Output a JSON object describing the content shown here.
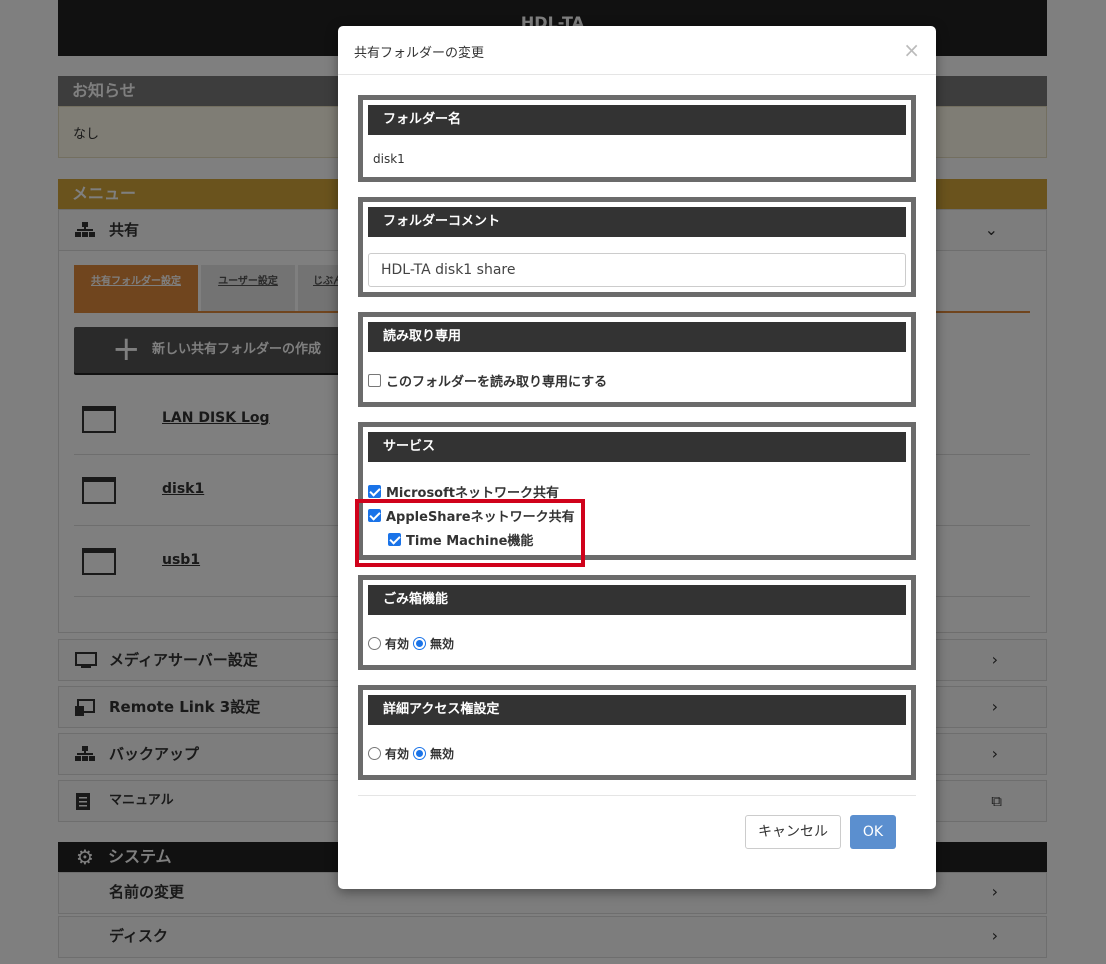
{
  "app": {
    "title": "HDL-TA"
  },
  "notice": {
    "heading": "お知らせ",
    "body": "なし"
  },
  "menu": {
    "heading": "メニュー",
    "share": {
      "label": "共有"
    },
    "tabs": [
      {
        "label": "共有フォルダー設定"
      },
      {
        "label": "ユーザー設定"
      },
      {
        "label": "じぶん"
      }
    ],
    "new_folder_button": "新しい共有フォルダーの作成",
    "folders": [
      {
        "name": "LAN DISK Log"
      },
      {
        "name": "disk1"
      },
      {
        "name": "usb1"
      }
    ],
    "rows": [
      {
        "label": "メディアサーバー設定"
      },
      {
        "label": "Remote Link 3設定"
      },
      {
        "label": "バックアップ"
      },
      {
        "label": "マニュアル"
      }
    ]
  },
  "system": {
    "heading": "システム",
    "rows": [
      {
        "label": "名前の変更"
      },
      {
        "label": "ディスク"
      }
    ]
  },
  "modal": {
    "title": "共有フォルダーの変更",
    "close_symbol": "×",
    "folder_name": {
      "heading": "フォルダー名",
      "value": "disk1"
    },
    "folder_comment": {
      "heading": "フォルダーコメント",
      "value": "HDL-TA disk1 share"
    },
    "read_only": {
      "heading": "読み取り専用",
      "option_label": "このフォルダーを読み取り専用にする",
      "checked": false
    },
    "service": {
      "heading": "サービス",
      "options": [
        {
          "label": "Microsoftネットワーク共有",
          "checked": true
        },
        {
          "label": "AppleShareネットワーク共有",
          "checked": true
        },
        {
          "label": "Time Machine機能",
          "checked": true
        }
      ]
    },
    "trash": {
      "heading": "ごみ箱機能",
      "enabled_label": "有効",
      "disabled_label": "無効",
      "selected": "無効"
    },
    "access": {
      "heading": "詳細アクセス権設定",
      "enabled_label": "有効",
      "disabled_label": "無効",
      "selected": "無効"
    },
    "cancel_label": "キャンセル",
    "ok_label": "OK"
  },
  "colors": {
    "menu_header": "#d4a73a",
    "active_tab": "#e08a3c",
    "highlight_box": "#d0021b",
    "ok_button": "#5b8fcf",
    "checkbox_accent": "#1a73e8"
  }
}
